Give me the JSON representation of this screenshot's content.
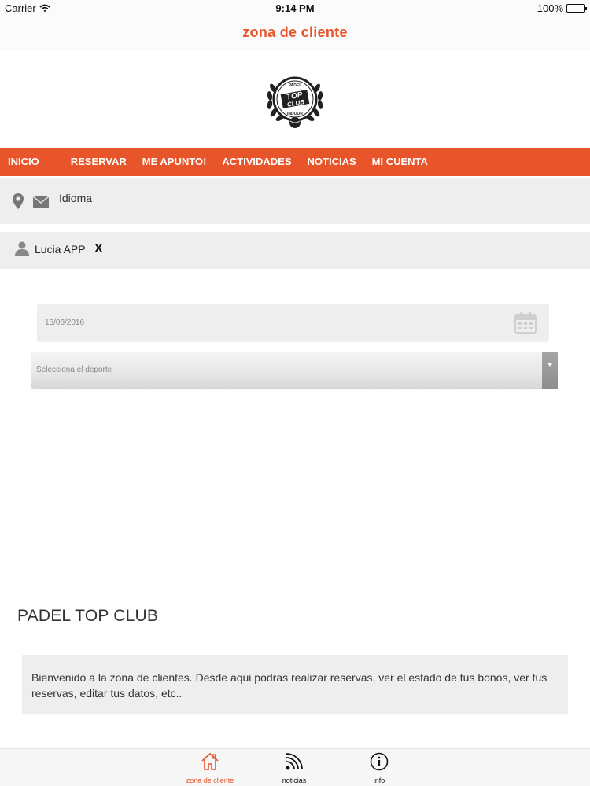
{
  "status_bar": {
    "carrier": "Carrier",
    "time": "9:14 PM",
    "battery": "100%"
  },
  "nav": {
    "title": "zona de cliente"
  },
  "logo": {
    "line1": "PADEL",
    "line2": "TOP",
    "line3": "CLUB",
    "line4": "INDOOR"
  },
  "menu": {
    "items": [
      {
        "label": "INICIO"
      },
      {
        "label": "RESERVAR"
      },
      {
        "label": "ME APUNTO!"
      },
      {
        "label": "ACTIVIDADES"
      },
      {
        "label": "NOTICIAS"
      },
      {
        "label": "MI CUENTA"
      }
    ]
  },
  "info_bar": {
    "language_label": "Idioma"
  },
  "user_bar": {
    "username": "Lucia APP",
    "logout_label": "X"
  },
  "form": {
    "date_value": "15/06/2016",
    "sport_placeholder": "Selecciona el deporte"
  },
  "club": {
    "title": "PADEL TOP CLUB",
    "welcome": "Bienvenido a la zona de clientes. Desde aqui podras realizar reservas, ver el estado de tus bonos, ver tus reservas, editar tus datos, etc.."
  },
  "tabs": [
    {
      "label": "zona de cliente",
      "icon": "home-icon",
      "active": true
    },
    {
      "label": "noticias",
      "icon": "rss-icon",
      "active": false
    },
    {
      "label": "info",
      "icon": "info-icon",
      "active": false
    }
  ],
  "colors": {
    "accent": "#e8552b",
    "panel": "#eeeeee"
  }
}
